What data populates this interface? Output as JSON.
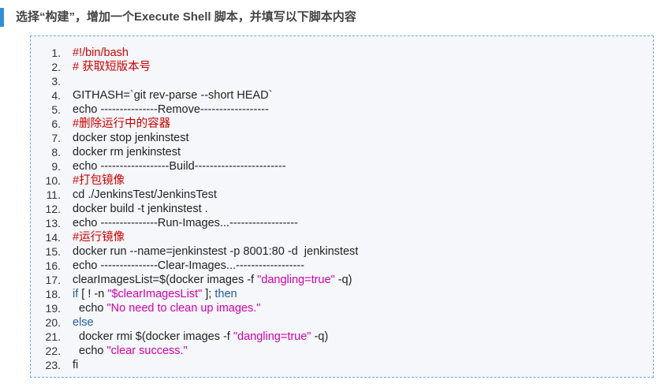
{
  "heading": "选择“构建”，增加一个Execute Shell 脚本，并填写以下脚本内容",
  "colors": {
    "accent_bar": "#2f8fd8",
    "comment": "#cc0000",
    "string": "#d400aa",
    "keyword": "#1f5f9e",
    "code_border": "#6fa9d4",
    "code_background": "#f5f7fa"
  },
  "code": {
    "lines": [
      {
        "n": "1.",
        "parts": [
          {
            "t": "#!/bin/bash",
            "c": "comment"
          }
        ]
      },
      {
        "n": "2.",
        "parts": [
          {
            "t": "# 获取短版本号",
            "c": "comment"
          }
        ]
      },
      {
        "n": "3.",
        "parts": [
          {
            "t": "",
            "c": "plain"
          }
        ]
      },
      {
        "n": "4.",
        "parts": [
          {
            "t": "GITHASH=`git rev-parse --short HEAD`",
            "c": "plain"
          }
        ]
      },
      {
        "n": "5.",
        "parts": [
          {
            "t": "echo ---------------Remove------------------",
            "c": "plain"
          }
        ]
      },
      {
        "n": "6.",
        "parts": [
          {
            "t": "#删除运行中的容器",
            "c": "comment"
          }
        ]
      },
      {
        "n": "7.",
        "parts": [
          {
            "t": "docker stop jenkinstest",
            "c": "plain"
          }
        ]
      },
      {
        "n": "8.",
        "parts": [
          {
            "t": "docker rm jenkinstest",
            "c": "plain"
          }
        ]
      },
      {
        "n": "9.",
        "parts": [
          {
            "t": "echo ------------------Build------------------------",
            "c": "plain"
          }
        ]
      },
      {
        "n": "10.",
        "parts": [
          {
            "t": "#打包镜像",
            "c": "comment"
          }
        ]
      },
      {
        "n": "11.",
        "parts": [
          {
            "t": "cd ./JenkinsTest/JenkinsTest",
            "c": "plain"
          }
        ]
      },
      {
        "n": "12.",
        "parts": [
          {
            "t": "docker build -t jenkinstest .",
            "c": "plain"
          }
        ]
      },
      {
        "n": "13.",
        "parts": [
          {
            "t": "echo ---------------Run-Images...------------------",
            "c": "plain"
          }
        ]
      },
      {
        "n": "14.",
        "parts": [
          {
            "t": "#运行镜像",
            "c": "comment"
          }
        ]
      },
      {
        "n": "15.",
        "parts": [
          {
            "t": "docker run --name=jenkinstest -p 8001:80 -d  jenkinstest",
            "c": "plain"
          }
        ]
      },
      {
        "n": "16.",
        "parts": [
          {
            "t": "echo ---------------Clear-Images...------------------",
            "c": "plain"
          }
        ]
      },
      {
        "n": "17.",
        "parts": [
          {
            "t": "clearImagesList=$(docker images -f ",
            "c": "plain"
          },
          {
            "t": "\"dangling=true\"",
            "c": "str"
          },
          {
            "t": " -q)",
            "c": "plain"
          }
        ]
      },
      {
        "n": "18.",
        "parts": [
          {
            "t": "if",
            "c": "kw"
          },
          {
            "t": " [ ! -n ",
            "c": "plain"
          },
          {
            "t": "\"$clearImagesList\"",
            "c": "str"
          },
          {
            "t": " ]; ",
            "c": "plain"
          },
          {
            "t": "then",
            "c": "kw"
          }
        ]
      },
      {
        "n": "19.",
        "parts": [
          {
            "t": "  echo ",
            "c": "plain"
          },
          {
            "t": "\"No need to clean up images.\"",
            "c": "str"
          }
        ]
      },
      {
        "n": "20.",
        "parts": [
          {
            "t": "else",
            "c": "kw"
          }
        ]
      },
      {
        "n": "21.",
        "parts": [
          {
            "t": "  docker rmi $(docker images -f ",
            "c": "plain"
          },
          {
            "t": "\"dangling=true\"",
            "c": "str"
          },
          {
            "t": " -q)",
            "c": "plain"
          }
        ]
      },
      {
        "n": "22.",
        "parts": [
          {
            "t": "  echo ",
            "c": "plain"
          },
          {
            "t": "\"clear success.\"",
            "c": "str"
          }
        ]
      },
      {
        "n": "23.",
        "parts": [
          {
            "t": "fi",
            "c": "plain"
          }
        ]
      }
    ]
  }
}
